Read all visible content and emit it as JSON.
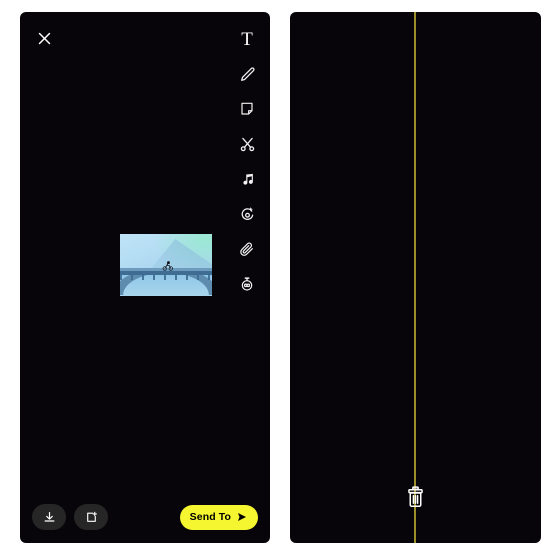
{
  "app": {
    "theme_background": "#070509",
    "accent_color": "#f5f530",
    "playhead_color": "#9c8f2a"
  },
  "editor_panel": {
    "name": "snap-editor",
    "close_button": {
      "icon": "close-icon",
      "label": "Close"
    },
    "tools": [
      {
        "id": "text",
        "icon": "text-icon",
        "label": "T",
        "glyph": "T"
      },
      {
        "id": "draw",
        "icon": "pencil-icon",
        "label": "Draw"
      },
      {
        "id": "sticker",
        "icon": "sticker-icon",
        "label": "Stickers"
      },
      {
        "id": "cut",
        "icon": "scissors-icon",
        "label": "Cutout"
      },
      {
        "id": "music",
        "icon": "music-note-icon",
        "label": "Sounds"
      },
      {
        "id": "magic",
        "icon": "magic-star-icon",
        "label": "Enhance"
      },
      {
        "id": "attach",
        "icon": "paperclip-icon",
        "label": "Attach Link"
      },
      {
        "id": "timer",
        "icon": "timer-icon",
        "label": "Timer"
      }
    ],
    "media": {
      "name": "cyclist-on-bridge",
      "alt": "Cyclist riding across a bridge over water with mountains"
    },
    "bottom_bar": {
      "save_button": {
        "icon": "download-icon",
        "label": "Save"
      },
      "story_button": {
        "icon": "add-to-story-icon",
        "label": "Add to Story"
      },
      "send_button": {
        "label": "Send To",
        "icon": "send-arrow-icon"
      }
    }
  },
  "timeline_panel": {
    "name": "snap-timeline",
    "playhead": {
      "label": "Playhead",
      "position_percent": 49
    },
    "clip": {
      "name": "cyclist-on-bridge-clip",
      "alt": "Cyclist riding across a bridge over water with mountains"
    },
    "trash": {
      "icon": "trash-icon",
      "label": "Delete clip"
    }
  }
}
